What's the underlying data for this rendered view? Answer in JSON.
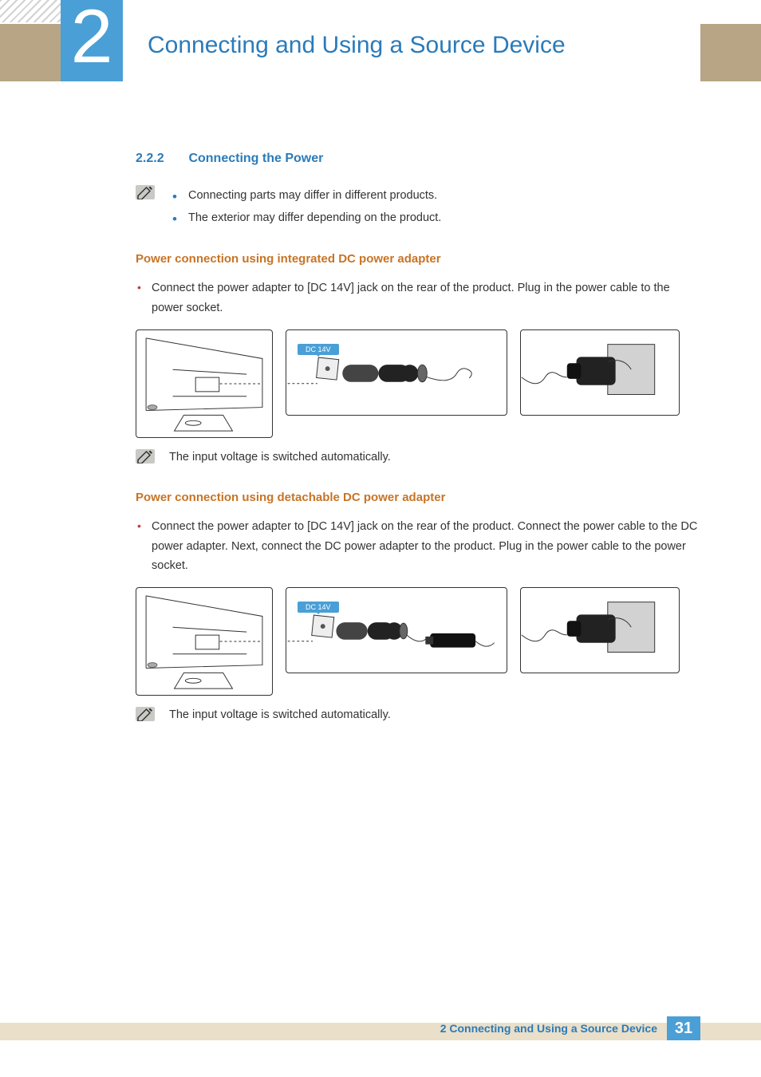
{
  "header": {
    "chapter_number": "2",
    "title": "Connecting and Using a Source Device"
  },
  "section": {
    "number": "2.2.2",
    "title": "Connecting the Power"
  },
  "notes": {
    "intro_bullets": [
      "Connecting parts may differ in different products.",
      "The exterior may differ depending on the product."
    ]
  },
  "subsection1": {
    "heading": "Power connection using integrated DC power adapter",
    "bullet": "Connect the power adapter to [DC 14V] jack on the rear of the product. Plug in the power cable to the power socket.",
    "port_label": "DC 14V",
    "footnote": "The input voltage is switched automatically."
  },
  "subsection2": {
    "heading": "Power connection using detachable DC power adapter",
    "bullet": "Connect the power adapter to [DC 14V] jack on the rear of the product. Connect the power cable to the DC power adapter. Next, connect the DC power adapter to the product. Plug in the power cable to the power socket.",
    "port_label": "DC 14V",
    "footnote": "The input voltage is switched automatically."
  },
  "footer": {
    "text": "2 Connecting and Using a Source Device",
    "page_number": "31"
  }
}
